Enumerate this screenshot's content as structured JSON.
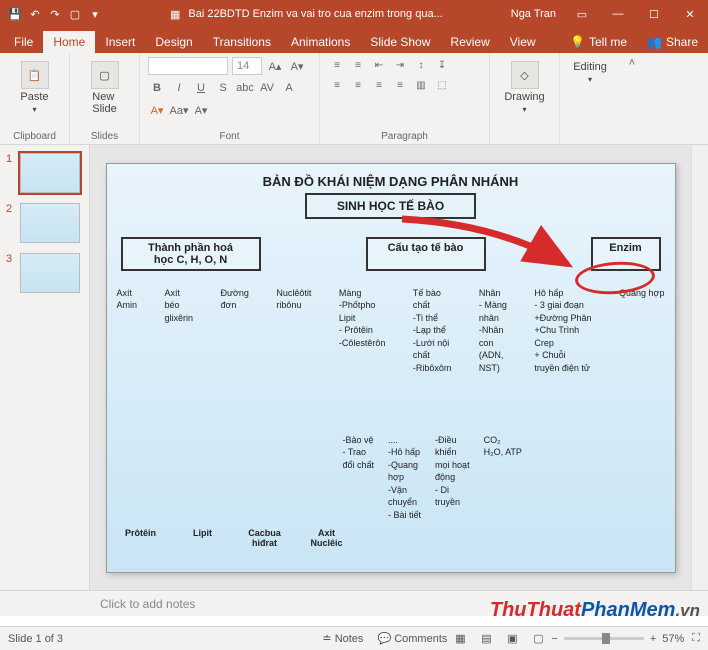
{
  "titlebar": {
    "doc_title": "Bai 22BDTD Enzim va vai tro cua enzim trong qua...",
    "user": "Nga Tran"
  },
  "tabs": {
    "file": "File",
    "home": "Home",
    "insert": "Insert",
    "design": "Design",
    "transitions": "Transitions",
    "animations": "Animations",
    "slideshow": "Slide Show",
    "review": "Review",
    "view": "View",
    "tellme": "Tell me",
    "share": "Share"
  },
  "ribbon": {
    "clipboard": "Clipboard",
    "paste": "Paste",
    "slides": "Slides",
    "newslide": "New\nSlide",
    "font": "Font",
    "font_size": "14",
    "paragraph": "Paragraph",
    "drawing": "Drawing",
    "editing": "Editing"
  },
  "thumbs": {
    "n1": "1",
    "n2": "2",
    "n3": "3"
  },
  "slide": {
    "title": "BẢN ĐỒ KHÁI NIỆM DẠNG PHÂN NHÁNH",
    "root": "SINH HỌC TẾ BÀO",
    "b1": "Thành phần hoá\nhọc C, H, O, N",
    "b2": "Cấu tạo tế bào",
    "b3": "Enzim",
    "c1": "Axít\nAmin",
    "c2": "Axít\nbéo\nglixêrin",
    "c3": "Đường\nđơn",
    "c4": "Nuclêôtit\nribônu",
    "c5": "Màng\n-Phốtpho\nLipit\n- Prôtêin\n-Côlestêrôn",
    "c6": "Tế bào\nchất\n-Ti thể\n-Lạp thể\n-Lưới nội\nchất\n-Ribôxôm",
    "c7": "Nhân\n- Màng\nnhân\n-Nhân\ncon\n(ADN,\nNST)",
    "c8": "Hô hấp\n- 3 giai đoạn\n+Đường Phân\n+Chu Trình\nCrep\n+ Chuỗi\ntruyền điện tử",
    "c9": "Quang hợp",
    "m5": "-Bảo vệ\n- Trao\nđổi chất",
    "m6": "....\n-Hô hấp\n-Quang\nhợp\n-Vận\nchuyển\n- Bài tiết",
    "m7": "-Điều\nkhiển\nmọi hoạt\nđộng\n- Di\ntruyền",
    "m8": "CO₂\nH₂O, ATP",
    "l1": "Prôtêin",
    "l2": "Lipit",
    "l3": "Cacbua\nhiđrat",
    "l4": "Axit\nNuclêic"
  },
  "notes": {
    "placeholder": "Click to add notes"
  },
  "status": {
    "slide": "Slide 1 of 3",
    "lang": "",
    "notes": "Notes",
    "comments": "Comments",
    "zoom": "57%"
  },
  "watermark": {
    "a": "ThuThuat",
    "b": "PhanMem",
    "c": ".vn"
  }
}
